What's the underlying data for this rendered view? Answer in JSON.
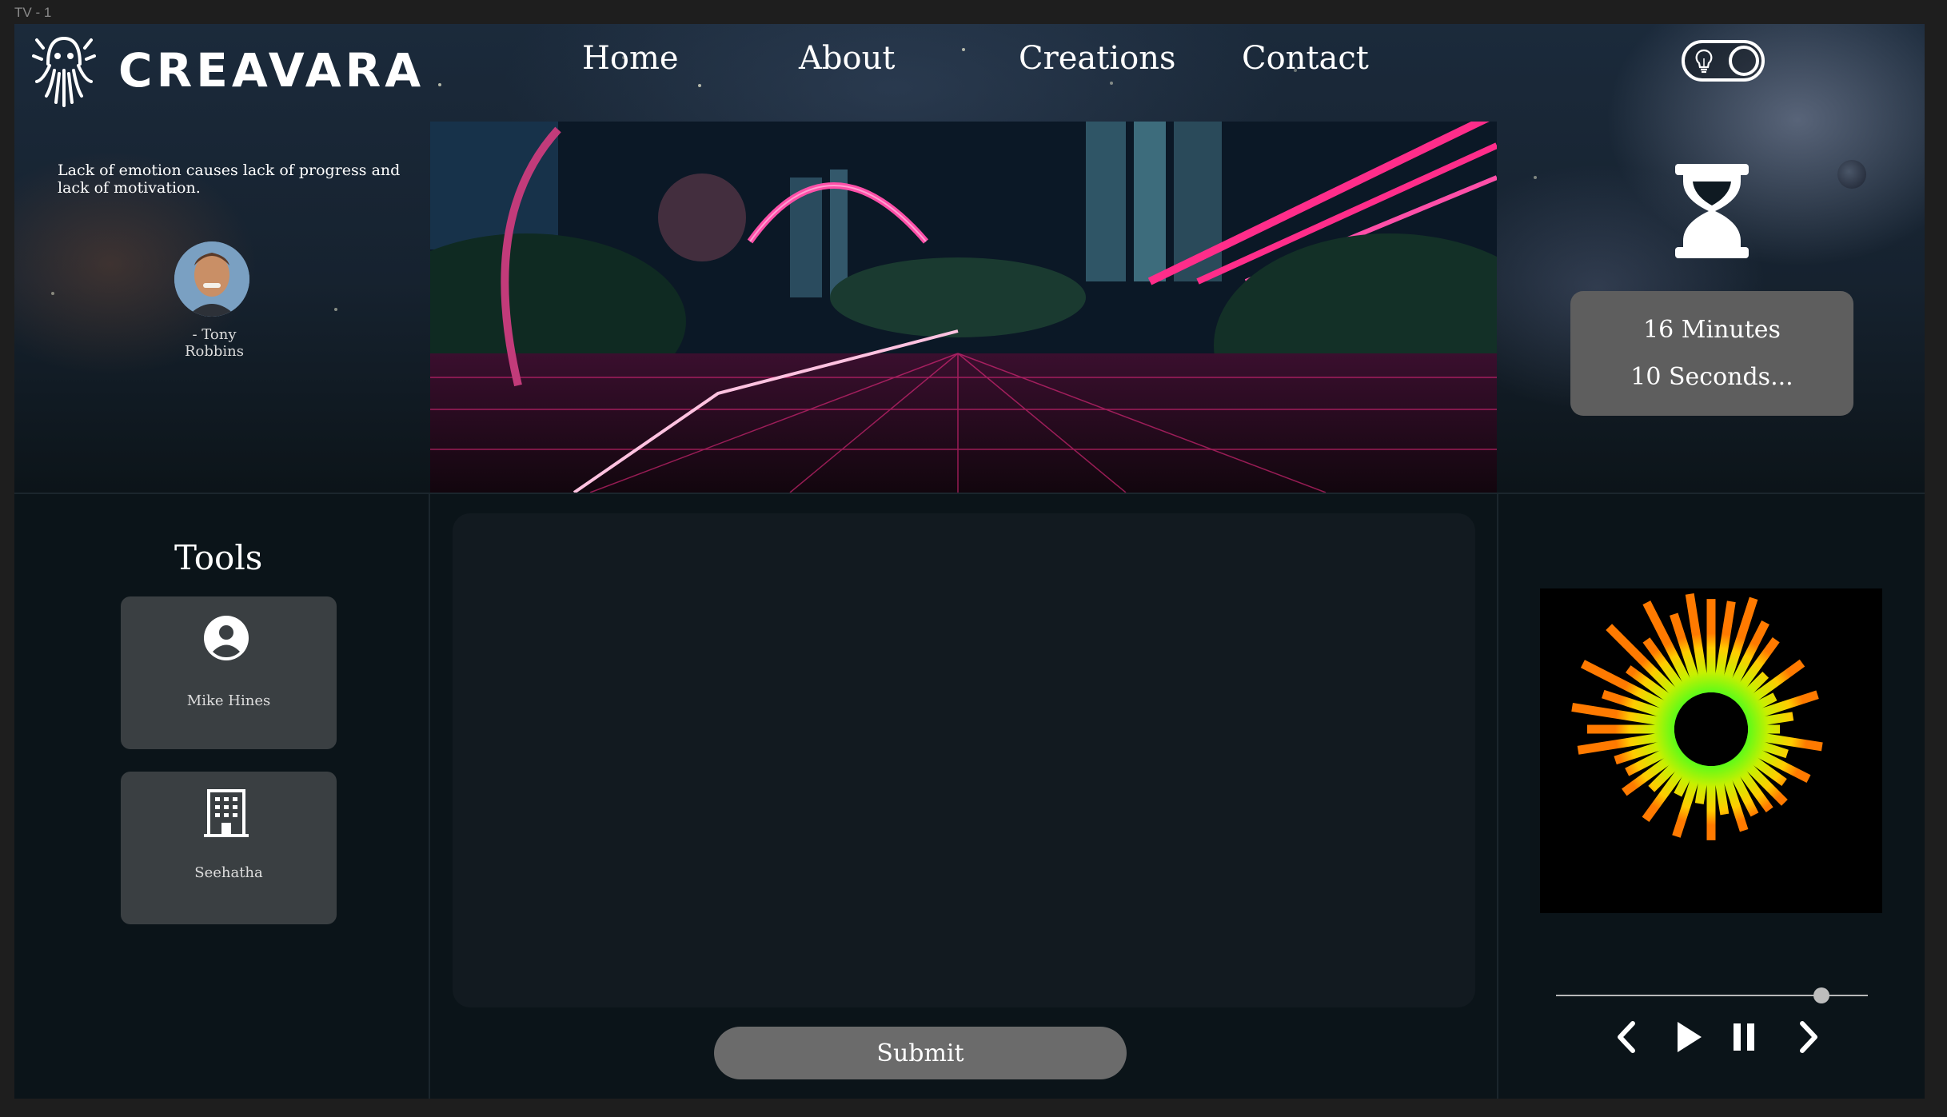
{
  "frame_label": "TV - 1",
  "header": {
    "brand": "CREAVARA",
    "nav": [
      "Home",
      "About",
      "Creations",
      "Contact"
    ]
  },
  "quote": {
    "text": "Lack of emotion causes lack of progress and lack of motivation.",
    "author": "- Tony Robbins"
  },
  "timer": {
    "minutes": "16 Minutes",
    "seconds": "10 Seconds..."
  },
  "tools": {
    "title": "Tools",
    "items": [
      {
        "label": "Mike Hines",
        "icon": "user-circle-icon"
      },
      {
        "label": "Seehatha",
        "icon": "building-icon"
      }
    ]
  },
  "form": {
    "input_value": "",
    "submit_label": "Submit"
  },
  "player": {
    "progress": 0.85
  },
  "colors": {
    "frame_bg": "#0b1419",
    "card_bg": "#3a3f42",
    "timer_bg": "#5e5e5e",
    "button_bg": "#6b6b6b",
    "neon_pink": "#ff2d8a"
  }
}
